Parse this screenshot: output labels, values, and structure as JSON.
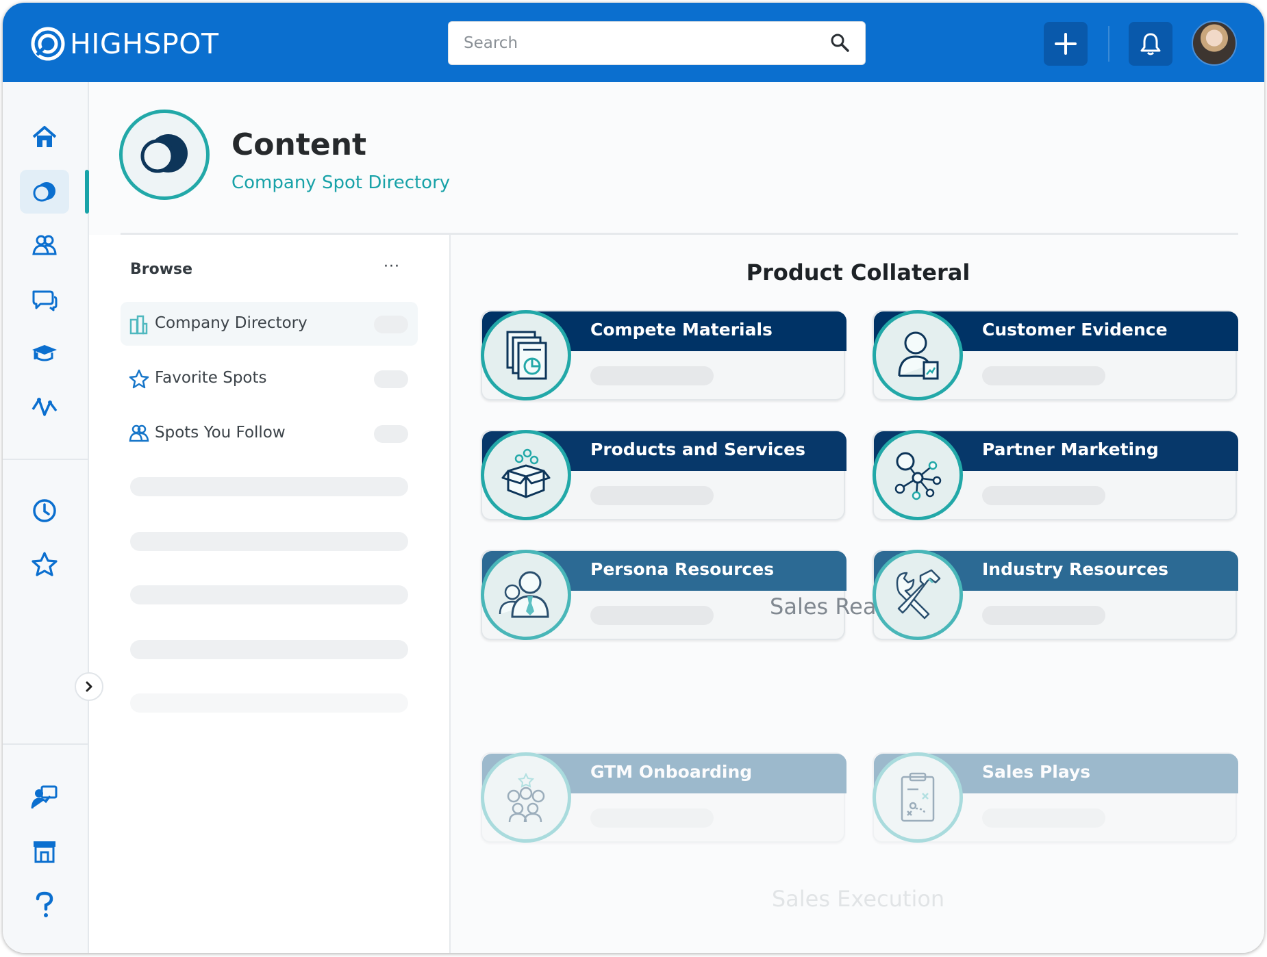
{
  "app": {
    "brand": "HIGHSPOT"
  },
  "search": {
    "placeholder": "Search"
  },
  "colors": {
    "topbar": "#0b6fcf",
    "accent": "#18a2a8",
    "card_header_dark": "#003366"
  },
  "rail": {
    "top_items": [
      "home-icon",
      "content-icon",
      "people-icon",
      "chat-icon",
      "training-icon",
      "analytics-icon"
    ],
    "mid_items": [
      "clock-icon",
      "star-icon"
    ],
    "bottom_items": [
      "presenter-icon",
      "store-icon",
      "help-icon"
    ]
  },
  "header": {
    "title": "Content",
    "subtitle": "Company Spot Directory"
  },
  "browse": {
    "title": "Browse",
    "more": "···",
    "items": [
      {
        "label": "Company Directory",
        "icon": "buildings-icon"
      },
      {
        "label": "Favorite Spots",
        "icon": "star-icon"
      },
      {
        "label": "Spots You Follow",
        "icon": "people-icon"
      }
    ]
  },
  "sections": [
    {
      "title": "Product Collateral",
      "cards": [
        {
          "title": "Compete Materials",
          "icon": "documents-chart-icon"
        },
        {
          "title": "Customer Evidence",
          "icon": "person-document-icon"
        },
        {
          "title": "Products and Services",
          "icon": "open-box-icon"
        },
        {
          "title": "Partner Marketing",
          "icon": "network-icon"
        },
        {
          "title": "Persona Resources",
          "icon": "persona-icon"
        },
        {
          "title": "Industry Resources",
          "icon": "tools-icon"
        }
      ]
    },
    {
      "title": "Sales Readiness",
      "cards": [
        {
          "title": "GTM Onboarding",
          "icon": "team-icon"
        },
        {
          "title": "Sales Plays",
          "icon": "playbook-icon"
        }
      ]
    },
    {
      "title": "Sales Execution",
      "cards": []
    }
  ]
}
